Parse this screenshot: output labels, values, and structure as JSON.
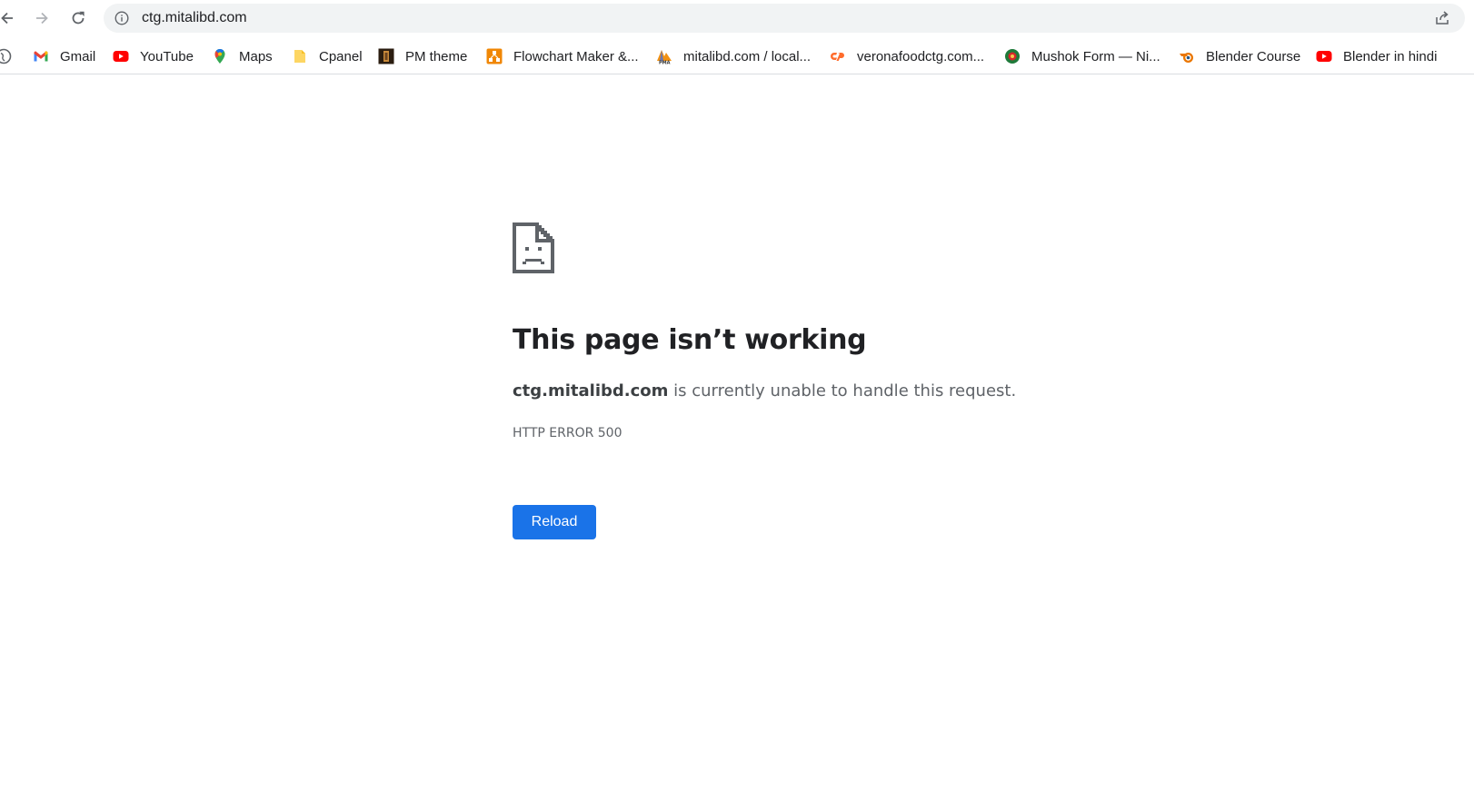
{
  "browser": {
    "url": "ctg.mitalibd.com",
    "nav": {
      "back_icon": "arrow-left-icon",
      "forward_icon": "arrow-right-icon",
      "reload_icon": "reload-icon",
      "info_icon": "info-circle-icon",
      "share_icon": "share-icon"
    }
  },
  "bookmarks": [
    {
      "label": "Gmail",
      "icon": "gmail-icon"
    },
    {
      "label": "YouTube",
      "icon": "youtube-icon"
    },
    {
      "label": "Maps",
      "icon": "maps-pin-icon"
    },
    {
      "label": "Cpanel",
      "icon": "folder-icon"
    },
    {
      "label": "PM theme",
      "icon": "pm-theme-icon"
    },
    {
      "label": "Flowchart Maker &...",
      "icon": "flowchart-icon"
    },
    {
      "label": "mitalibd.com / local...",
      "icon": "phpmyadmin-icon"
    },
    {
      "label": "veronafoodctg.com...",
      "icon": "cpanel-icon"
    },
    {
      "label": "Mushok Form — Ni...",
      "icon": "mushok-icon"
    },
    {
      "label": "Blender Course",
      "icon": "blender-icon"
    },
    {
      "label": "Blender in hindi",
      "icon": "youtube-icon"
    }
  ],
  "error": {
    "icon": "sad-page-icon",
    "title": "This page isn’t working",
    "host": "ctg.mitalibd.com",
    "message": " is currently unable to handle this request.",
    "code": "HTTP ERROR 500",
    "reload_label": "Reload"
  },
  "colors": {
    "accent": "#1a73e8",
    "omnibox_bg": "#f1f3f4",
    "text_secondary": "#5f6368"
  }
}
